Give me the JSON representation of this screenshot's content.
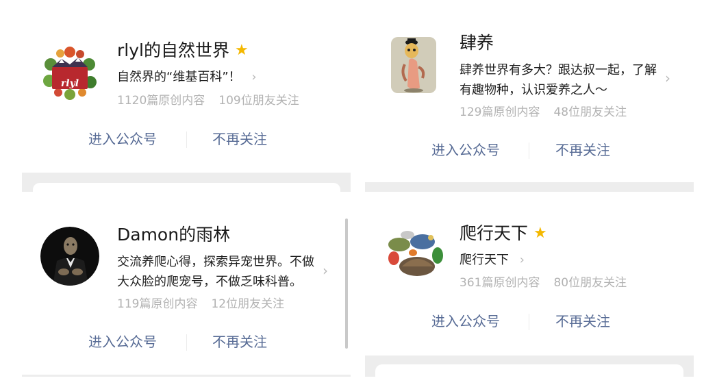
{
  "cards": [
    {
      "name": "rlyl的自然世界",
      "starred": true,
      "description": [
        "自然界的“维基百科”！"
      ],
      "articles": "1120篇原创内容",
      "followers": "109位朋友关注",
      "avatar_icon": "rlyl-logo-icon",
      "avatar_text": "rlyl",
      "enter_label": "进入公众号",
      "unfollow_label": "不再关注"
    },
    {
      "name": "肆养",
      "starred": false,
      "description": [
        "肆养世界有多大？跟达叔一起，了解",
        "有趣物种，认识爱养之人～"
      ],
      "articles": "129篇原创内容",
      "followers": "48位朋友关注",
      "avatar_icon": "figurine-icon",
      "enter_label": "进入公众号",
      "unfollow_label": "不再关注"
    },
    {
      "name": "Damon的雨林",
      "starred": false,
      "description": [
        "交流养爬心得，探索异宠世界。不做",
        "大众脸的爬宠号，不做乏味科普。"
      ],
      "articles": "119篇原创内容",
      "followers": "12位朋友关注",
      "avatar_icon": "turtle-in-suit-icon",
      "enter_label": "进入公众号",
      "unfollow_label": "不再关注"
    },
    {
      "name": "爬行天下",
      "starred": true,
      "description": [
        "爬行天下"
      ],
      "articles": "361篇原创内容",
      "followers": "80位朋友关注",
      "avatar_icon": "reptiles-icon",
      "enter_label": "进入公众号",
      "unfollow_label": "不再关注"
    }
  ],
  "colors": {
    "link": "#576b95",
    "star": "#f4b800",
    "secondary_text": "#b2b2b2",
    "separator": "#ededed"
  }
}
